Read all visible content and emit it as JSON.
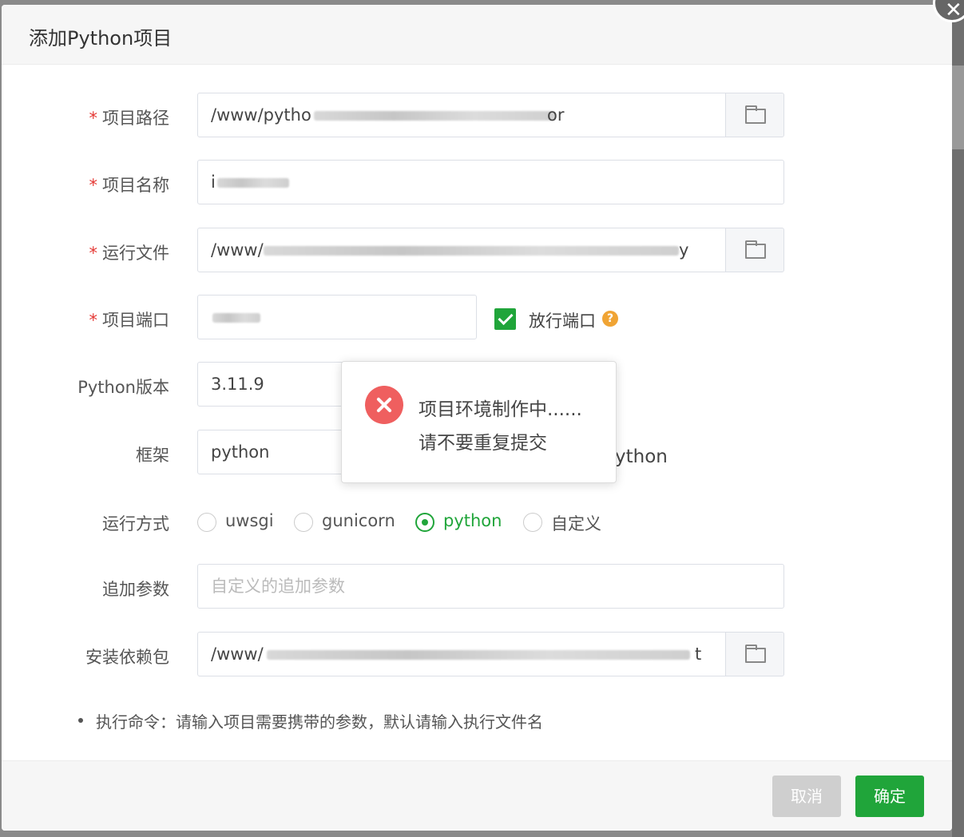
{
  "dialog": {
    "title": "添加Python项目",
    "close_label": "✕"
  },
  "form": {
    "project_path": {
      "label": "项目路径",
      "value_prefix": "/www/pytho",
      "value_suffix": "or"
    },
    "project_name": {
      "label": "项目名称",
      "value_prefix": "i"
    },
    "run_file": {
      "label": "运行文件",
      "value_prefix": "/www/",
      "value_suffix": "y"
    },
    "project_port": {
      "label": "项目端口",
      "open_port_label": "放行端口",
      "open_port_checked": true,
      "help_icon": "?"
    },
    "python_version": {
      "label": "Python版本",
      "value": "3.11.9"
    },
    "framework": {
      "label": "框架",
      "value": "python",
      "partial_text_behind": "ython"
    },
    "run_mode": {
      "label": "运行方式",
      "options": [
        {
          "label": "uwsgi",
          "checked": false
        },
        {
          "label": "gunicorn",
          "checked": false
        },
        {
          "label": "python",
          "checked": true
        },
        {
          "label": "自定义",
          "checked": false
        }
      ]
    },
    "extra_params": {
      "label": "追加参数",
      "placeholder": "自定义的追加参数"
    },
    "requirements": {
      "label": "安装依赖包",
      "value_prefix": "/www/",
      "value_suffix": "t"
    },
    "required_mark": "*"
  },
  "tip": "执行命令：请输入项目需要携带的参数，默认请输入执行文件名",
  "footer": {
    "cancel_label": "取消",
    "ok_label": "确定"
  },
  "toast": {
    "line1": "项目环境制作中......",
    "line2": "请不要重复提交"
  },
  "colors": {
    "accent": "#20a53a",
    "error": "#ef5f5f",
    "required": "#e53935",
    "help": "#f0a434"
  }
}
